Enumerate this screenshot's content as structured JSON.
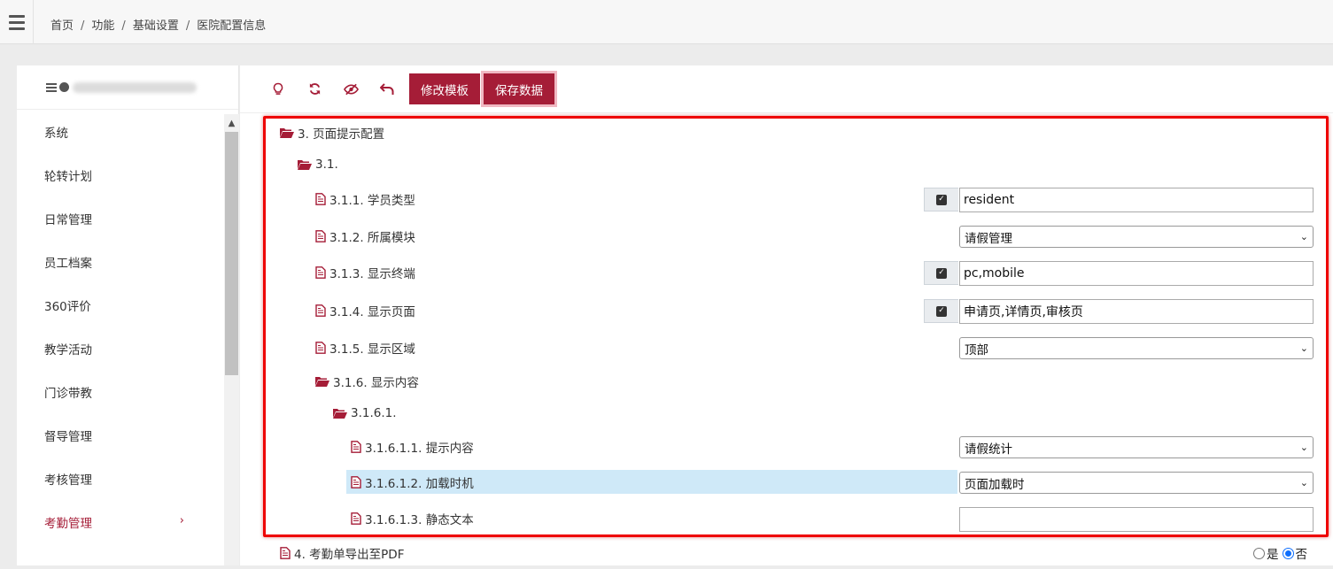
{
  "breadcrumb": [
    "首页",
    "功能",
    "基础设置",
    "医院配置信息"
  ],
  "sidebar": {
    "items": [
      {
        "label": "系统"
      },
      {
        "label": "轮转计划"
      },
      {
        "label": "日常管理"
      },
      {
        "label": "员工档案"
      },
      {
        "label": "360评价"
      },
      {
        "label": "教学活动"
      },
      {
        "label": "门诊带教"
      },
      {
        "label": "督导管理"
      },
      {
        "label": "考核管理"
      },
      {
        "label": "考勤管理",
        "active": true,
        "chevron": "›"
      }
    ]
  },
  "toolbar": {
    "edit_template": "修改模板",
    "save_data": "保存数据"
  },
  "tree": {
    "n3": "3. 页面提示配置",
    "n31": "3.1.",
    "n311": {
      "label": "3.1.1. 学员类型",
      "checked": true,
      "value": "resident"
    },
    "n312": {
      "label": "3.1.2. 所属模块",
      "value": "请假管理"
    },
    "n313": {
      "label": "3.1.3. 显示终端",
      "checked": true,
      "value": "pc,mobile"
    },
    "n314": {
      "label": "3.1.4. 显示页面",
      "checked": true,
      "value": "申请页,详情页,审核页"
    },
    "n315": {
      "label": "3.1.5. 显示区域",
      "value": "顶部"
    },
    "n316": "3.1.6. 显示内容",
    "n3161": "3.1.6.1.",
    "n31611": {
      "label": "3.1.6.1.1. 提示内容",
      "value": "请假统计"
    },
    "n31612": {
      "label": "3.1.6.1.2. 加载时机",
      "value": "页面加载时"
    },
    "n31613": {
      "label": "3.1.6.1.3. 静态文本",
      "value": ""
    },
    "n4": {
      "label": "4. 考勤单导出至PDF",
      "yes": "是",
      "no": "否",
      "selected": "否"
    }
  },
  "colors": {
    "accent": "#a51d37",
    "highlight": "#cfe9f8",
    "annotation": "#e00000"
  }
}
